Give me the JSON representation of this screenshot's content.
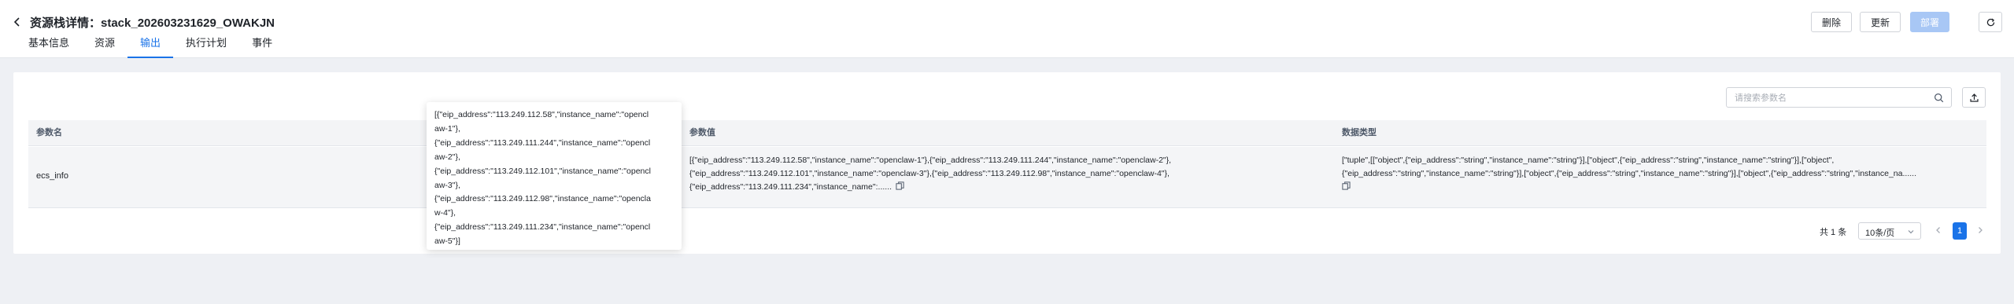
{
  "header": {
    "title": "资源栈详情：stack_202603231629_OWAKJN",
    "tabs": [
      {
        "label": "基本信息",
        "active": false
      },
      {
        "label": "资源",
        "active": false
      },
      {
        "label": "输出",
        "active": true
      },
      {
        "label": "执行计划",
        "active": false
      },
      {
        "label": "事件",
        "active": false
      }
    ],
    "actions": {
      "delete_label": "删除",
      "update_label": "更新",
      "deploy_label": "部署"
    }
  },
  "toolbar": {
    "search_placeholder": "请搜索参数名",
    "search_value": ""
  },
  "table": {
    "columns": [
      "参数名",
      "参数值",
      "数据类型"
    ],
    "rows": [
      {
        "name": "ecs_info",
        "value_lines": [
          "[{\"eip_address\":\"113.249.112.58\",\"instance_name\":\"openclaw-1\"},{\"eip_address\":\"113.249.111.244\",\"instance_name\":\"openclaw-2\"},",
          "{\"eip_address\":\"113.249.112.101\",\"instance_name\":\"openclaw-3\"},{\"eip_address\":\"113.249.112.98\",\"instance_name\":\"openclaw-4\"},",
          "{\"eip_address\":\"113.249.111.234\",\"instance_name\":......"
        ],
        "type_lines": [
          "[\"tuple\",[[\"object\",{\"eip_address\":\"string\",\"instance_name\":\"string\"}],[\"object\",{\"eip_address\":\"string\",\"instance_name\":\"string\"}],[\"object\",",
          "{\"eip_address\":\"string\",\"instance_name\":\"string\"}],[\"object\",{\"eip_address\":\"string\",\"instance_name\":\"string\"}],[\"object\",{\"eip_address\":\"string\",\"instance_na......"
        ]
      }
    ]
  },
  "tooltip": {
    "lines": [
      "[{\"eip_address\":\"113.249.112.58\",\"instance_name\":\"opencl",
      "aw-1\"},",
      "{\"eip_address\":\"113.249.111.244\",\"instance_name\":\"opencl",
      "aw-2\"},",
      "{\"eip_address\":\"113.249.112.101\",\"instance_name\":\"opencl",
      "aw-3\"},",
      "{\"eip_address\":\"113.249.112.98\",\"instance_name\":\"openclа",
      "w-4\"},",
      "{\"eip_address\":\"113.249.111.234\",\"instance_name\":\"opencl",
      "aw-5\"}]"
    ]
  },
  "pagination": {
    "total_text": "共 1 条",
    "page_size": "10条/页",
    "current_page": "1"
  },
  "colors": {
    "accent": "#1a73e8",
    "deploy_disabled": "#a8c7f5",
    "page_background": "#eef0f4",
    "header_background": "#f3f4f6"
  },
  "icons": [
    "back-icon",
    "refresh-icon",
    "search-icon",
    "export-icon",
    "copy-icon",
    "chevron-down-icon",
    "chevron-left-icon",
    "chevron-right-icon"
  ]
}
